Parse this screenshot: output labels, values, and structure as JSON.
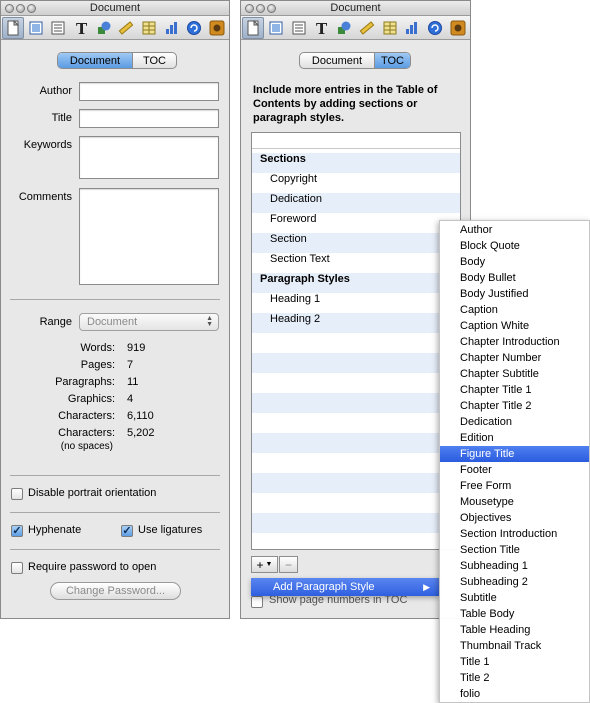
{
  "left_window": {
    "title": "Document",
    "segments": [
      "Document",
      "TOC"
    ],
    "active_segment": "Document",
    "fields": {
      "author_label": "Author",
      "title_label": "Title",
      "keywords_label": "Keywords",
      "comments_label": "Comments",
      "author_value": "",
      "title_value": "",
      "keywords_value": "",
      "comments_value": ""
    },
    "range": {
      "label": "Range",
      "value": "Document"
    },
    "stats": [
      {
        "label": "Words:",
        "value": "919"
      },
      {
        "label": "Pages:",
        "value": "7"
      },
      {
        "label": "Paragraphs:",
        "value": "11"
      },
      {
        "label": "Graphics:",
        "value": "4"
      },
      {
        "label": "Characters:",
        "value": "6,110"
      },
      {
        "label": "Characters:",
        "value": "5,202"
      }
    ],
    "no_spaces_note": "(no spaces)",
    "disable_portrait": {
      "label": "Disable portrait orientation",
      "checked": false
    },
    "hyphenate": {
      "label": "Hyphenate",
      "checked": true
    },
    "ligatures": {
      "label": "Use ligatures",
      "checked": true
    },
    "require_password": {
      "label": "Require password to open",
      "checked": false
    },
    "change_password_label": "Change Password..."
  },
  "right_window": {
    "title": "Document",
    "segments": [
      "Document",
      "TOC"
    ],
    "active_segment": "TOC",
    "help_text": "Include more entries in the Table of Contents by adding sections or paragraph styles.",
    "toc_rows": [
      {
        "text": "Sections",
        "kind": "group"
      },
      {
        "text": "Copyright",
        "kind": "item"
      },
      {
        "text": "Dedication",
        "kind": "item"
      },
      {
        "text": "Foreword",
        "kind": "item"
      },
      {
        "text": "Section",
        "kind": "item"
      },
      {
        "text": "Section Text",
        "kind": "item"
      },
      {
        "text": "Paragraph Styles",
        "kind": "group"
      },
      {
        "text": "Heading 1",
        "kind": "item"
      },
      {
        "text": "Heading 2",
        "kind": "item"
      }
    ],
    "add_label": "+",
    "remove_label": "−",
    "show_page_numbers": "Show page numbers in TOC",
    "add_paragraph_style": "Add Paragraph Style"
  },
  "style_menu": {
    "items": [
      "Author",
      "Block Quote",
      "Body",
      "Body Bullet",
      "Body Justified",
      "Caption",
      "Caption White",
      "Chapter Introduction",
      "Chapter Number",
      "Chapter Subtitle",
      "Chapter Title 1",
      "Chapter Title 2",
      "Dedication",
      "Edition",
      "Figure Title",
      "Footer",
      "Free Form",
      "Mousetype",
      "Objectives",
      "Section Introduction",
      "Section Title",
      "Subheading 1",
      "Subheading 2",
      "Subtitle",
      "Table Body",
      "Table Heading",
      "Thumbnail Track",
      "Title 1",
      "Title 2",
      "folio"
    ],
    "highlighted": "Figure Title"
  },
  "toolbar_icons": [
    "document-inspector-icon",
    "layout-inspector-icon",
    "wrap-inspector-icon",
    "text-inspector-icon",
    "graphic-inspector-icon",
    "metrics-inspector-icon",
    "table-inspector-icon",
    "chart-inspector-icon",
    "link-inspector-icon",
    "quicktime-inspector-icon"
  ],
  "colors": {
    "selection": "#2f5fe0",
    "segment_on": "#5b9be3",
    "list_stripe": "#e6eefa"
  }
}
